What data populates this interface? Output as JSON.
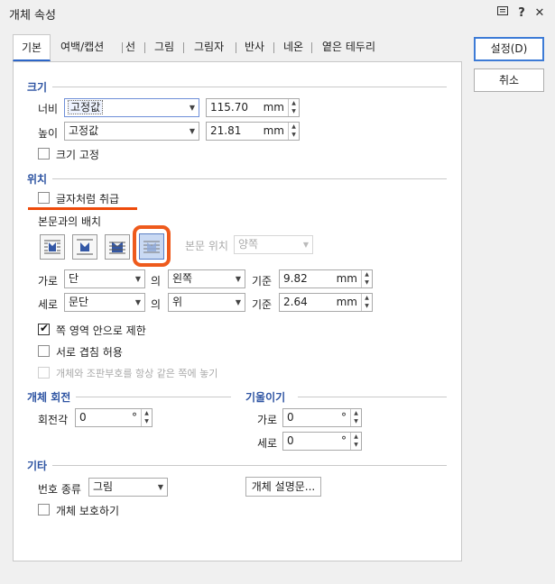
{
  "window": {
    "title": "개체 속성",
    "help_icon": "help-icon",
    "close_icon": "close-icon",
    "menu_icon": "menu-icon"
  },
  "tabs": [
    {
      "label": "기본"
    },
    {
      "label": "여백/캡션"
    },
    {
      "label": "선"
    },
    {
      "label": "그림"
    },
    {
      "label": "그림자"
    },
    {
      "label": "반사"
    },
    {
      "label": "네온"
    },
    {
      "label": "옅은 테두리"
    }
  ],
  "buttons": {
    "ok": "설정(D)",
    "cancel": "취소"
  },
  "size": {
    "header": "크기",
    "width_label": "너비",
    "width_mode": "고정값",
    "width_value": "115.70",
    "width_unit": "mm",
    "height_label": "높이",
    "height_mode": "고정값",
    "height_value": "21.81",
    "height_unit": "mm",
    "fix_size_label": "크기 고정"
  },
  "position": {
    "header": "위치",
    "treat_as_char_label": "글자처럼 취급",
    "wrap_label": "본문과의 배치",
    "text_position_label": "본문 위치",
    "text_position_value": "양쪽",
    "horiz_label": "가로",
    "horiz_ref": "단",
    "horiz_of": "의",
    "horiz_align": "왼쪽",
    "horiz_base_label": "기준",
    "horiz_value": "9.82",
    "horiz_unit": "mm",
    "vert_label": "세로",
    "vert_ref": "문단",
    "vert_of": "의",
    "vert_align": "위",
    "vert_base_label": "기준",
    "vert_value": "2.64",
    "vert_unit": "mm",
    "limit_label": "쪽 영역 안으로 제한",
    "overlap_label": "서로 겹침 허용",
    "same_side_label": "개체와 조판부호를 항상 같은 쪽에 놓기"
  },
  "rotation": {
    "header": "개체 회전",
    "angle_label": "회전각",
    "angle_value": "0",
    "angle_unit": "°"
  },
  "skew": {
    "header": "기울이기",
    "horiz_label": "가로",
    "horiz_value": "0",
    "vert_label": "세로",
    "vert_value": "0",
    "unit": "°"
  },
  "etc": {
    "header": "기타",
    "number_type_label": "번호 종류",
    "number_type_value": "그림",
    "description_button": "개체 설명문...",
    "protect_label": "개체 보호하기"
  },
  "colors": {
    "section_header": "#2f55a3",
    "highlight": "#ee5a1c",
    "accent": "#2c66c8"
  }
}
